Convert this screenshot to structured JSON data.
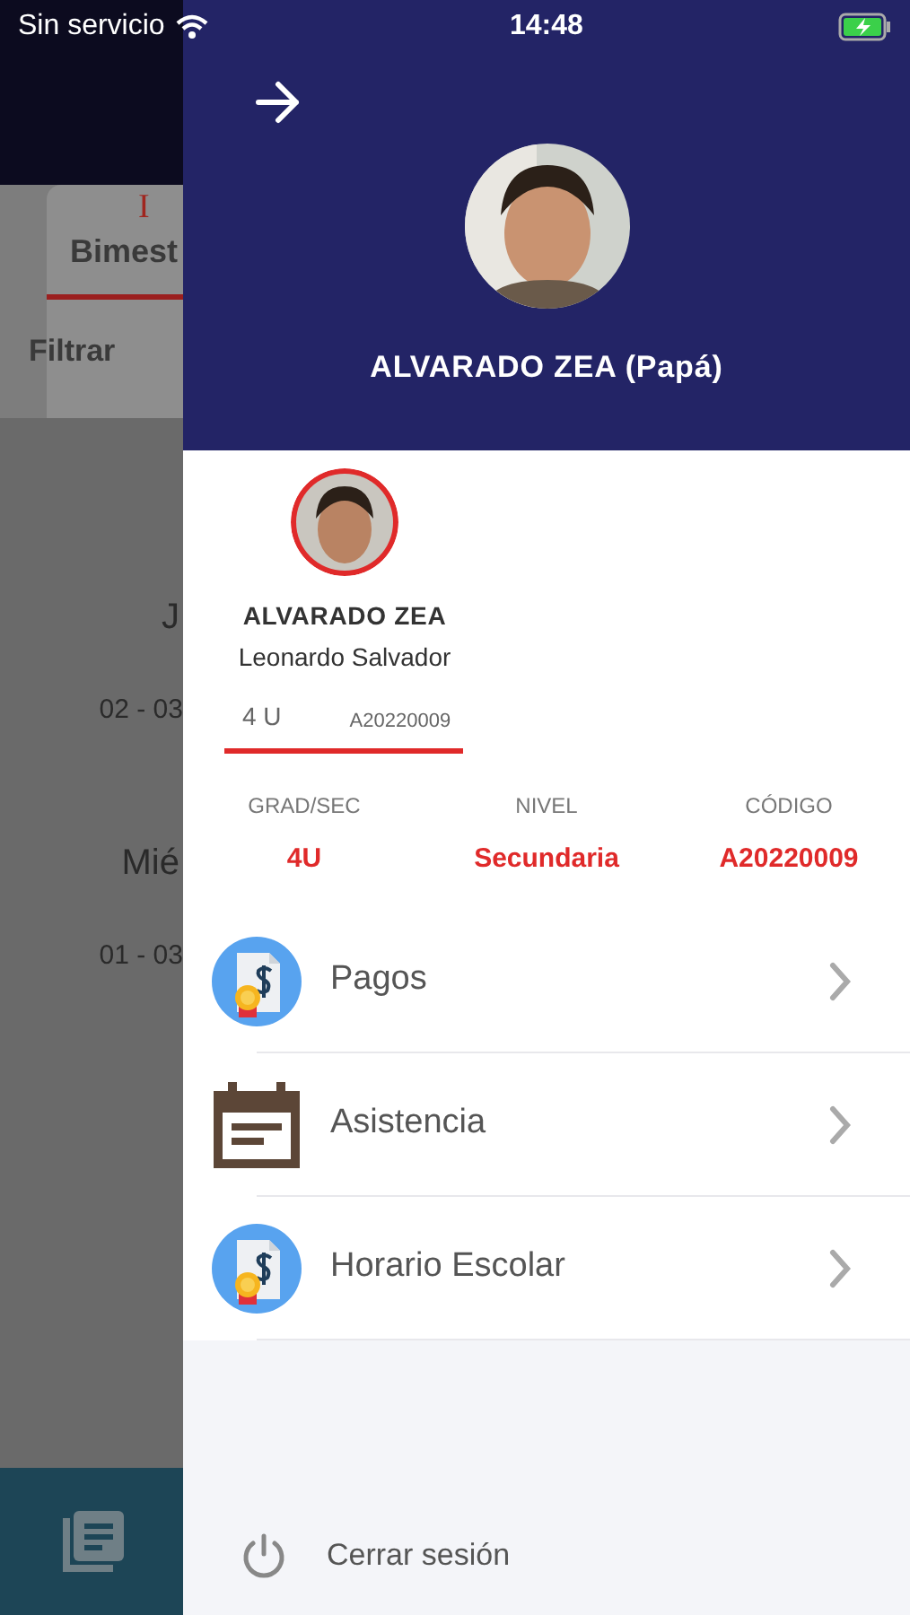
{
  "status_bar": {
    "carrier": "Sin servicio",
    "time": "14:48"
  },
  "background": {
    "tab": {
      "numeral": "I",
      "label": "Bimest",
      "selected": true
    },
    "filter": "Filtrar",
    "entries": [
      {
        "day": "J",
        "date": "02 - 03"
      },
      {
        "day": "Mié",
        "date": "01 - 03"
      }
    ]
  },
  "drawer": {
    "parent_name": "ALVARADO ZEA (Papá)",
    "student": {
      "surname": "ALVARADO ZEA",
      "given_names": "Leonardo Salvador",
      "grade": "4 U",
      "code": "A20220009"
    },
    "info": [
      {
        "label": "GRAD/SEC",
        "value": "4U"
      },
      {
        "label": "NIVEL",
        "value": "Secundaria"
      },
      {
        "label": "CÓDIGO",
        "value": "A20220009"
      }
    ],
    "menu": [
      {
        "label": "Pagos",
        "kind": "payment"
      },
      {
        "label": "Asistencia",
        "kind": "calendar"
      },
      {
        "label": "Horario Escolar",
        "kind": "payment"
      }
    ],
    "logout": "Cerrar sesión"
  }
}
